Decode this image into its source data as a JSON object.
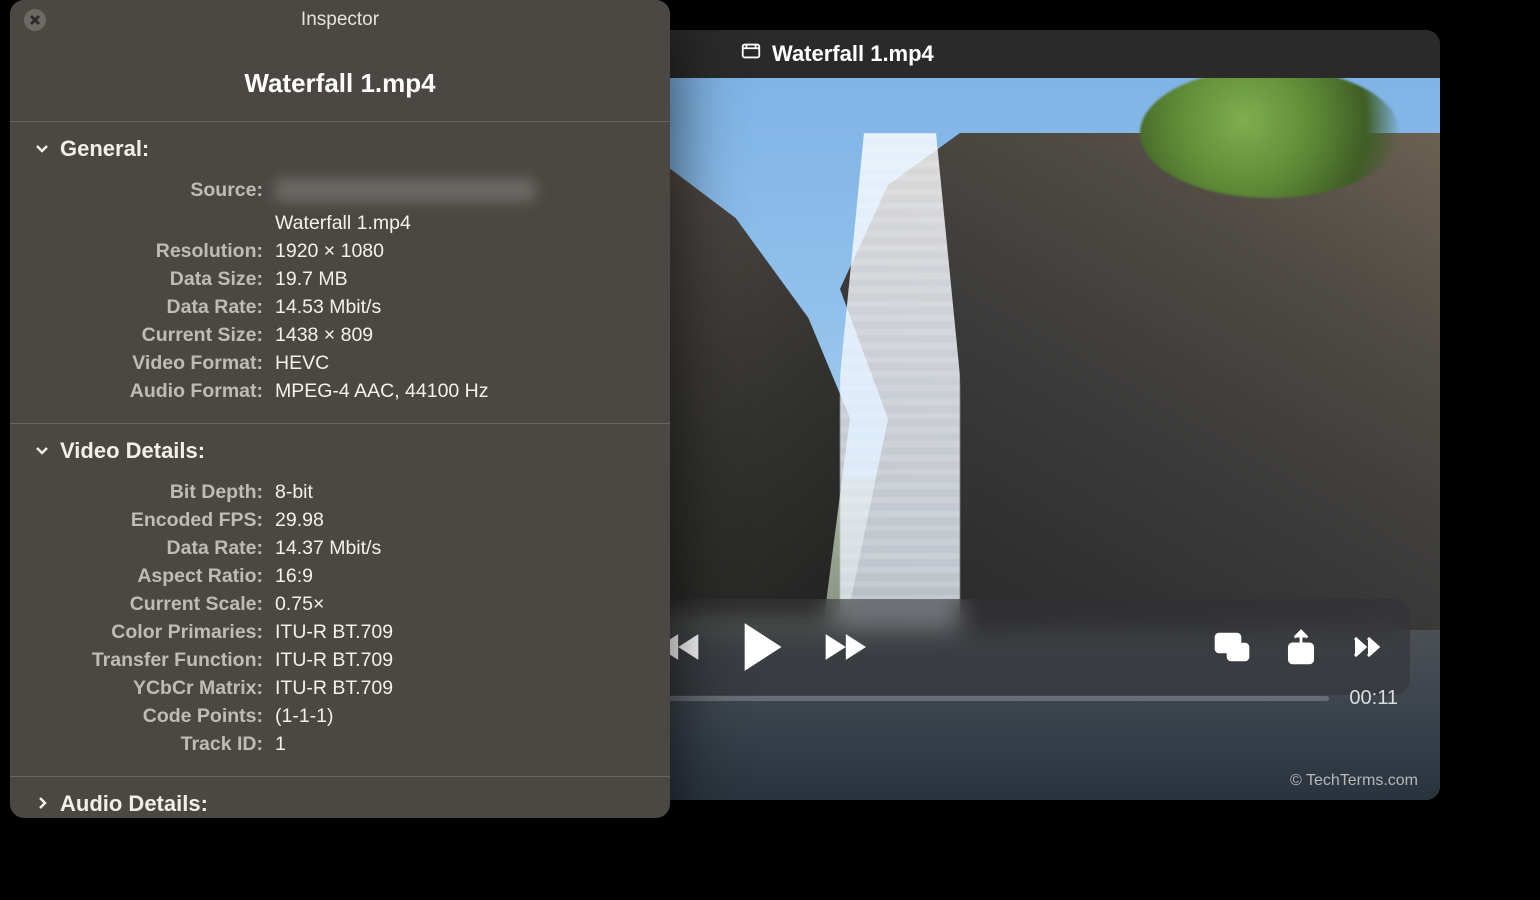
{
  "player": {
    "titlebar_filename": "Waterfall 1.mp4",
    "timecode": "00:11",
    "watermark": "© TechTerms.com"
  },
  "inspector": {
    "window_title": "Inspector",
    "filename": "Waterfall 1.mp4",
    "sections": {
      "general": {
        "header": "General:",
        "rows": {
          "source_label": "Source:",
          "source_value_line2": "Waterfall 1.mp4",
          "resolution_label": "Resolution:",
          "resolution_value": "1920 × 1080",
          "data_size_label": "Data Size:",
          "data_size_value": "19.7 MB",
          "data_rate_label": "Data Rate:",
          "data_rate_value": "14.53 Mbit/s",
          "current_size_label": "Current Size:",
          "current_size_value": "1438 × 809",
          "video_format_label": "Video Format:",
          "video_format_value": "HEVC",
          "audio_format_label": "Audio Format:",
          "audio_format_value": "MPEG-4 AAC, 44100 Hz"
        }
      },
      "video_details": {
        "header": "Video Details:",
        "rows": {
          "bit_depth_label": "Bit Depth:",
          "bit_depth_value": "8-bit",
          "encoded_fps_label": "Encoded FPS:",
          "encoded_fps_value": "29.98",
          "data_rate_label": "Data Rate:",
          "data_rate_value": "14.37 Mbit/s",
          "aspect_ratio_label": "Aspect Ratio:",
          "aspect_ratio_value": "16:9",
          "current_scale_label": "Current Scale:",
          "current_scale_value": "0.75×",
          "color_primaries_label": "Color Primaries:",
          "color_primaries_value": "ITU-R BT.709",
          "transfer_function_label": "Transfer Function:",
          "transfer_function_value": "ITU-R BT.709",
          "ycbcr_matrix_label": "YCbCr Matrix:",
          "ycbcr_matrix_value": "ITU-R BT.709",
          "code_points_label": "Code Points:",
          "code_points_value": "(1-1-1)",
          "track_id_label": "Track ID:",
          "track_id_value": "1"
        }
      },
      "audio_details": {
        "header": "Audio Details:"
      }
    }
  }
}
